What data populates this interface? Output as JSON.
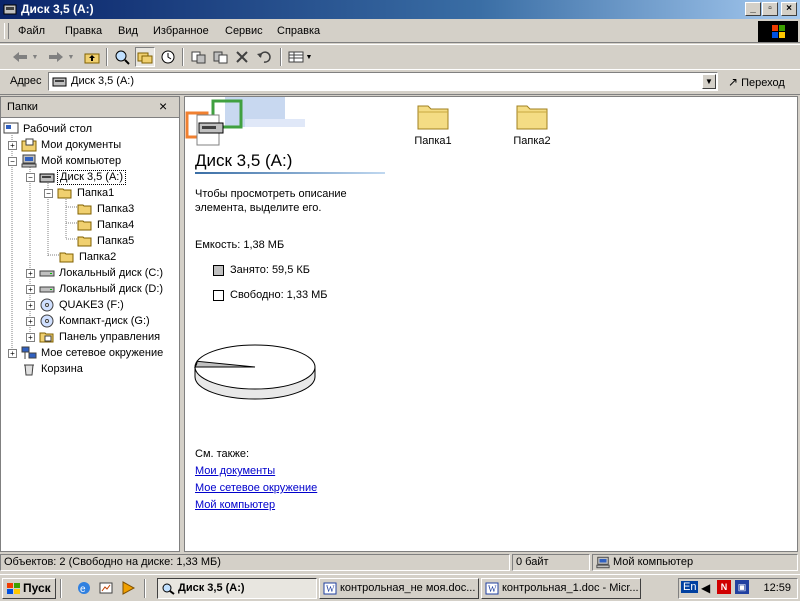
{
  "window": {
    "title": "Диск 3,5 (A:)"
  },
  "menu": [
    {
      "label": "Файл"
    },
    {
      "label": "Правка"
    },
    {
      "label": "Вид"
    },
    {
      "label": "Избранное"
    },
    {
      "label": "Сервис"
    },
    {
      "label": "Справка"
    }
  ],
  "address": {
    "label": "Адрес",
    "value": "Диск 3,5 (A:)",
    "go_label": "Переход"
  },
  "folders_pane": {
    "title": "Папки",
    "tree": [
      {
        "label": "Рабочий стол"
      },
      {
        "label": "Мои документы"
      },
      {
        "label": "Мой компьютер"
      },
      {
        "label": "Диск 3,5 (A:)"
      },
      {
        "label": "Папка1"
      },
      {
        "label": "Папка3"
      },
      {
        "label": "Папка4"
      },
      {
        "label": "Папка5"
      },
      {
        "label": "Папка2"
      },
      {
        "label": "Локальный диск (C:)"
      },
      {
        "label": "Локальный диск (D:)"
      },
      {
        "label": "QUAKE3 (F:)"
      },
      {
        "label": "Компакт-диск (G:)"
      },
      {
        "label": "Панель управления"
      },
      {
        "label": "Мое сетевое окружение"
      },
      {
        "label": "Корзина"
      }
    ]
  },
  "content": {
    "drive_title": "Диск 3,5 (A:)",
    "hint_line1": "Чтобы просмотреть описание",
    "hint_line2": "элемента, выделите его.",
    "capacity": "Емкость: 1,38 МБ",
    "used": "Занято: 59,5 КБ",
    "free": "Свободно: 1,33 МБ",
    "used_fraction": 0.042,
    "see_also": "См. также:",
    "links": [
      "Мои документы",
      "Мое сетевое окружение",
      "Мой компьютер"
    ],
    "items": [
      {
        "label": "Папка1"
      },
      {
        "label": "Папка2"
      }
    ]
  },
  "statusbar": {
    "objects": "Объектов: 2 (Свободно на диске: 1,33 МБ)",
    "size": "0 байт",
    "zone": "Мой компьютер"
  },
  "taskbar": {
    "start": "Пуск",
    "tasks": [
      {
        "label": "Диск 3,5 (A:)"
      },
      {
        "label": "контрольная_не моя.doc..."
      },
      {
        "label": "контрольная_1.doc - Micr..."
      }
    ],
    "lang": "En",
    "clock": "12:59"
  },
  "colors": {
    "title_bar": "#0a246a",
    "link": "#0000cc",
    "face": "#d4d0c8"
  }
}
